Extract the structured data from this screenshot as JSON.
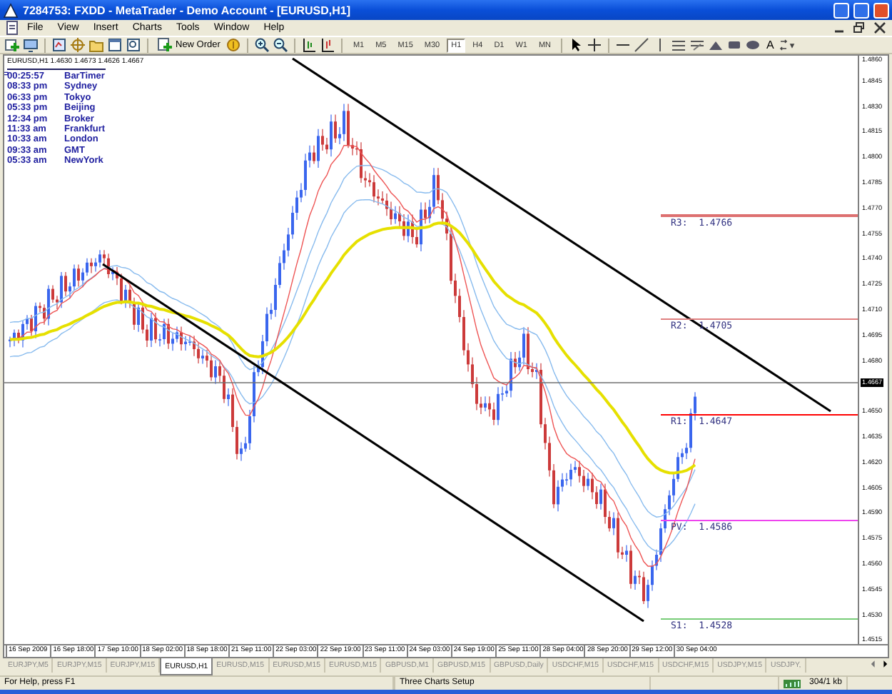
{
  "window": {
    "title": "7284753: FXDD - MetaTrader - Demo Account - [EURUSD,H1]"
  },
  "menu": [
    "File",
    "View",
    "Insert",
    "Charts",
    "Tools",
    "Window",
    "Help"
  ],
  "toolbar": {
    "new_order": "New Order",
    "text_tool": "A",
    "timeframes": [
      {
        "label": "M1",
        "selected": false
      },
      {
        "label": "M5",
        "selected": false
      },
      {
        "label": "M15",
        "selected": false
      },
      {
        "label": "M30",
        "selected": false
      },
      {
        "label": "H1",
        "selected": true
      },
      {
        "label": "H4",
        "selected": false
      },
      {
        "label": "D1",
        "selected": false
      },
      {
        "label": "W1",
        "selected": false
      },
      {
        "label": "MN",
        "selected": false
      }
    ]
  },
  "chart": {
    "header": "EURUSD,H1 1.4630 1.4673 1.4626 1.4667",
    "clocks": [
      {
        "time": "00:25:57",
        "city": "BarTimer",
        "kind": "timer"
      },
      {
        "time": "08:33 pm",
        "city": "Sydney",
        "kind": "city"
      },
      {
        "time": "06:33 pm",
        "city": "Tokyo",
        "kind": "city"
      },
      {
        "time": "05:33 pm",
        "city": "Beijing",
        "kind": "city"
      },
      {
        "time": "12:34 pm",
        "city": "Broker",
        "kind": "city"
      },
      {
        "time": "11:33 am",
        "city": "Frankfurt",
        "kind": "city"
      },
      {
        "time": "10:33 am",
        "city": "London",
        "kind": "city"
      },
      {
        "time": "09:33 am",
        "city": "GMT",
        "kind": "city"
      },
      {
        "time": "05:33 am",
        "city": "NewYork",
        "kind": "city"
      }
    ],
    "pivots": [
      {
        "label": "R3:  1.4766",
        "color": "#dd7070"
      },
      {
        "label": "R2:  1.4705",
        "color": "#e08080"
      },
      {
        "label": "R1:  1.4647",
        "color": "#ff0000"
      },
      {
        "label": "PV:  1.4586",
        "color": "#ee44ee"
      },
      {
        "label": "S1:  1.4528",
        "color": "#77cc77"
      }
    ],
    "price_axis": [
      "1.4860",
      "1.4845",
      "1.4830",
      "1.4815",
      "1.4800",
      "1.4785",
      "1.4770",
      "1.4755",
      "1.4740",
      "1.4725",
      "1.4710",
      "1.4695",
      "1.4680",
      "1.4650",
      "1.4635",
      "1.4620",
      "1.4605",
      "1.4590",
      "1.4575",
      "1.4560",
      "1.4545",
      "1.4530",
      "1.4515"
    ],
    "current_price": "1.4667",
    "time_axis": [
      "16 Sep 2009",
      "16 Sep 18:00",
      "17 Sep 10:00",
      "18 Sep 02:00",
      "18 Sep 18:00",
      "21 Sep 11:00",
      "22 Sep 03:00",
      "22 Sep 19:00",
      "23 Sep 11:00",
      "24 Sep 03:00",
      "24 Sep 19:00",
      "25 Sep 11:00",
      "28 Sep 04:00",
      "28 Sep 20:00",
      "29 Sep 12:00",
      "30 Sep 04:00"
    ]
  },
  "tabs": [
    {
      "label": "EURJPY,M5",
      "selected": false
    },
    {
      "label": "EURJPY,M15",
      "selected": false
    },
    {
      "label": "EURJPY,M15",
      "selected": false
    },
    {
      "label": "EURUSD,H1",
      "selected": true
    },
    {
      "label": "EURUSD,M15",
      "selected": false
    },
    {
      "label": "EURUSD,M15",
      "selected": false
    },
    {
      "label": "EURUSD,M15",
      "selected": false
    },
    {
      "label": "GBPUSD,M1",
      "selected": false
    },
    {
      "label": "GBPUSD,M15",
      "selected": false
    },
    {
      "label": "GBPUSD,Daily",
      "selected": false
    },
    {
      "label": "USDCHF,M15",
      "selected": false
    },
    {
      "label": "USDCHF,M15",
      "selected": false
    },
    {
      "label": "USDCHF,M15",
      "selected": false
    },
    {
      "label": "USDJPY,M15",
      "selected": false
    },
    {
      "label": "USDJPY,",
      "selected": false
    }
  ],
  "status_bar": {
    "help": "For Help, press F1",
    "profile": "Three Charts Setup",
    "traffic": "304/1 kb"
  }
}
